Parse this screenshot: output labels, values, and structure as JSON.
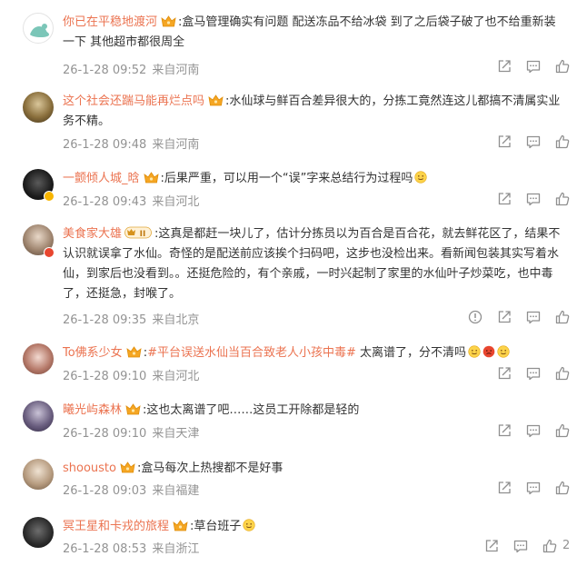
{
  "comments": [
    {
      "username": "你已在平稳地渡河",
      "text": ":盒马管理确实有问题 配送冻品不给冰袋 到了之后袋子破了也不给重新装一下 其他超市都很周全",
      "time": "26-1-28 09:52",
      "location": "来自河南"
    },
    {
      "username": "这个社会还踹马能再烂点吗",
      "text": ":水仙球与鲜百合差异很大的，分拣工竟然连这儿都搞不清属实业务不精。",
      "time": "26-1-28 09:48",
      "location": "来自河南"
    },
    {
      "username": "一颤倾人城_晗",
      "text": ":后果严重，可以用一个“误”字来总结行为过程吗",
      "time": "26-1-28 09:43",
      "location": "来自河北"
    },
    {
      "username": "美食家大雄",
      "vip_level": "II",
      "text": ":这真是都赶一块儿了，估计分拣员以为百合是百合花，就去鲜花区了，结果不认识就误拿了水仙。奇怪的是配送前应该挨个扫码吧，这步也没检出来。看新闻包装其实写着水仙，到家后也没看到。。还挺危险的，有个亲戚，一时兴起制了家里的水仙叶子炒菜吃，也中毒了，还挺急，封喉了。",
      "time": "26-1-28 09:35",
      "location": "来自北京"
    },
    {
      "username": "To佛系少女",
      "topic": "#平台误送水仙当百合致老人小孩中毒#",
      "text": " 太离谱了，分不清吗",
      "time": "26-1-28 09:10",
      "location": "来自河北"
    },
    {
      "username": "曦光屿森林",
      "text": ":这也太离谱了吧……这员工开除都是轻的",
      "time": "26-1-28 09:10",
      "location": "来自天津"
    },
    {
      "username": "shoousto",
      "text": ":盒马每次上热搜都不是好事",
      "time": "26-1-28 09:03",
      "location": "来自福建"
    },
    {
      "username": "冥王星和卡戎的旅程",
      "text": ":草台班子",
      "time": "26-1-28 08:53",
      "location": "来自浙江",
      "likes": "2"
    }
  ],
  "colors": {
    "username": "#eb7350",
    "meta": "#939393",
    "icon": "#8f8f8f"
  },
  "icons": {
    "share": "share-icon",
    "comment": "comment-icon",
    "like": "thumbs-up-icon",
    "report": "report-icon",
    "crown": "crown-badge-icon"
  }
}
